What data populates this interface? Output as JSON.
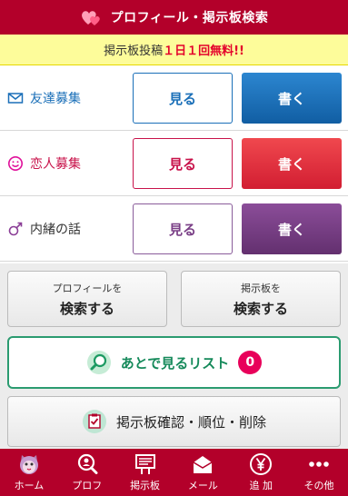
{
  "header": {
    "title": "プロフィール・掲示板検索"
  },
  "notice": {
    "prefix": "掲示板投稿",
    "highlight": "１日１回無料!!"
  },
  "board": {
    "rows": [
      {
        "label": "友達募集",
        "see": "見る",
        "write": "書く",
        "color": "#1a6fb8"
      },
      {
        "label": "恋人募集",
        "see": "見る",
        "write": "書く",
        "color": "#e23441"
      },
      {
        "label": "内緒の話",
        "see": "見る",
        "write": "書く",
        "color": "#7a3f86"
      }
    ]
  },
  "search": {
    "profile": {
      "small": "プロフィールを",
      "big": "検索する"
    },
    "board": {
      "small": "掲示板を",
      "big": "検索する"
    }
  },
  "later": {
    "label": "あとで見るリスト",
    "count": "0"
  },
  "confirm": {
    "label": "掲示板確認・順位・削除"
  },
  "footer": {
    "items": [
      {
        "label": "ホーム",
        "icon": "cat-avatar-icon"
      },
      {
        "label": "プロフ",
        "icon": "profile-search-icon"
      },
      {
        "label": "掲示板",
        "icon": "board-sign-icon"
      },
      {
        "label": "メール",
        "icon": "mail-icon"
      },
      {
        "label": "追 加",
        "icon": "yen-icon"
      },
      {
        "label": "その他",
        "icon": "more-icon"
      }
    ]
  }
}
